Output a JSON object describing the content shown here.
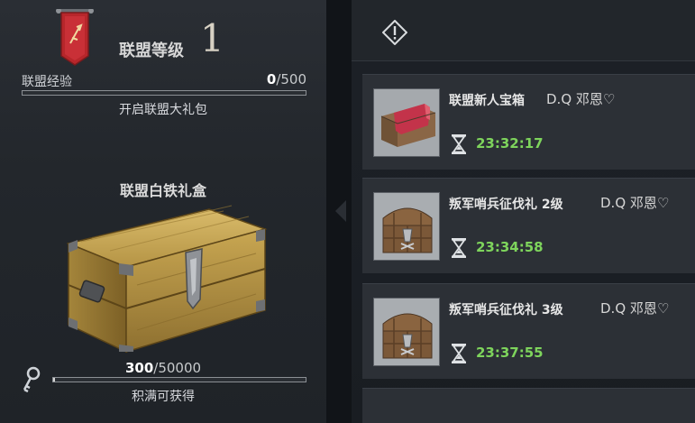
{
  "alliance": {
    "level_label": "联盟等级",
    "level": "1",
    "exp_label": "联盟经验",
    "exp_current": "0",
    "exp_max": "/500",
    "exp_progress": 0,
    "unlock_text": "开启联盟大礼包"
  },
  "gift_box": {
    "title": "联盟白铁礼盒",
    "key_current": "300",
    "key_max": "/50000",
    "key_progress": 0.006,
    "note": "积满可获得"
  },
  "gifts": [
    {
      "title": "联盟新人宝箱",
      "owner": "D.Q 邓恩♡",
      "timer": "23:32:17",
      "icon": "red-cloth-chest-icon"
    },
    {
      "title": "叛军哨兵征伐礼 2级",
      "owner": "D.Q 邓恩♡",
      "timer": "23:34:58",
      "icon": "wooden-chest-icon"
    },
    {
      "title": "叛军哨兵征伐礼 3级",
      "owner": "D.Q 邓恩♡",
      "timer": "23:37:55",
      "icon": "wooden-chest-icon"
    }
  ],
  "colors": {
    "timer": "#7ed45c",
    "banner": "#b7262b"
  }
}
